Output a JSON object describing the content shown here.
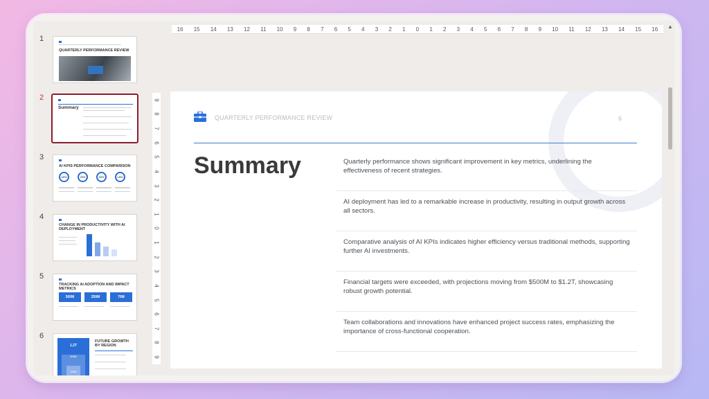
{
  "thumbnails": [
    {
      "num": "1",
      "title": "QUARTERLY PERFORMANCE REVIEW"
    },
    {
      "num": "2",
      "title": "Summary"
    },
    {
      "num": "3",
      "title": "AI KPIS PERFORMANCE COMPARISON"
    },
    {
      "num": "4",
      "title": "CHANGE IN PRODUCTIVITY WITH AI DEPLOYMENT"
    },
    {
      "num": "5",
      "title": "TRACKING AI ADOPTION AND IMPACT METRICS"
    },
    {
      "num": "6",
      "title": "FUTURE GROWTH BY REGION"
    }
  ],
  "selected_slide": "2",
  "ruler": {
    "horizontal": [
      "16",
      "15",
      "14",
      "13",
      "12",
      "11",
      "10",
      "9",
      "8",
      "7",
      "6",
      "5",
      "4",
      "3",
      "2",
      "1",
      "0",
      "1",
      "2",
      "3",
      "4",
      "5",
      "6",
      "7",
      "8",
      "9",
      "10",
      "11",
      "12",
      "13",
      "14",
      "15",
      "16"
    ],
    "vertical": [
      "9",
      "8",
      "7",
      "6",
      "5",
      "4",
      "3",
      "2",
      "1",
      "0",
      "1",
      "2",
      "3",
      "4",
      "5",
      "6",
      "7",
      "8",
      "9"
    ]
  },
  "slide": {
    "header": "QUARTERLY PERFORMANCE REVIEW",
    "page_number": "6",
    "title": "Summary",
    "accent": "#2a6ed8",
    "bullets": [
      "Quarterly performance shows significant improvement in key metrics, underlining the effectiveness of recent strategies.",
      "AI deployment has led to a remarkable increase in productivity, resulting in output growth across all sectors.",
      "Comparative analysis of AI KPIs indicates higher efficiency versus traditional methods, supporting further AI investments.",
      "Financial targets were exceeded, with projections moving from $500M to $1.2T, showcasing robust growth potential.",
      "Team collaborations and innovations have enhanced project success rates, emphasizing the importance of cross-functional cooperation."
    ]
  },
  "thumb_texts": {
    "t3_pcts": [
      "40%",
      "20%",
      "30%",
      "15%"
    ],
    "t5_values": [
      "500M",
      "250M",
      "70M"
    ],
    "t6_values": [
      "1.2T",
      "500B",
      "150B"
    ]
  }
}
